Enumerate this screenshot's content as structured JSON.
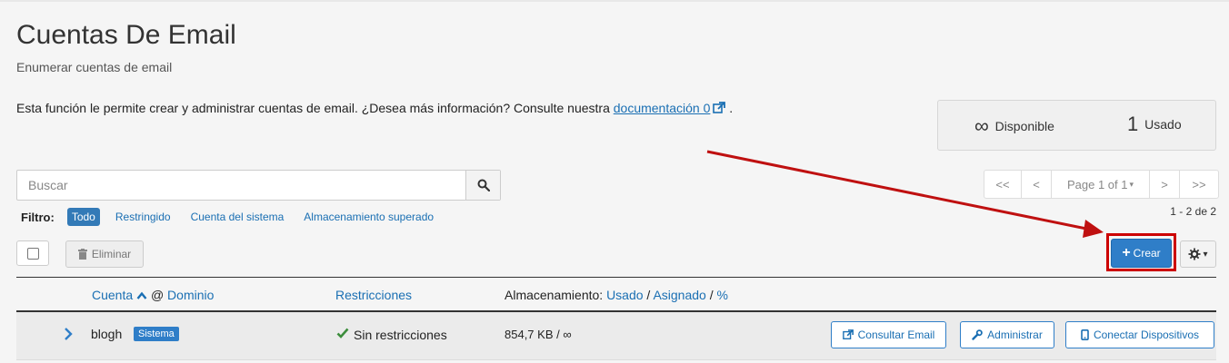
{
  "page": {
    "title": "Cuentas De Email",
    "subtitle": "Enumerar cuentas de email",
    "intro_text": "Esta función le permite crear y administrar cuentas de email. ¿Desea más información? Consulte nuestra",
    "doc_link": "documentación 0",
    "intro_end": "."
  },
  "stats": {
    "available_value": "∞",
    "available_label": "Disponible",
    "used_value": "1",
    "used_label": "Usado"
  },
  "search": {
    "placeholder": "Buscar"
  },
  "pagination": {
    "first": "<<",
    "prev": "<",
    "page_label": "Page 1 of 1",
    "next": ">",
    "last": ">>",
    "range": "1 - 2 de 2"
  },
  "filter": {
    "label": "Filtro:",
    "options": [
      "Todo",
      "Restringido",
      "Cuenta del sistema",
      "Almacenamiento superado"
    ],
    "active": "Todo"
  },
  "toolbar": {
    "delete_label": "Eliminar",
    "create_label": "Crear"
  },
  "table": {
    "col_account": "Cuenta",
    "col_at": "@",
    "col_domain": "Dominio",
    "col_restrictions": "Restricciones",
    "col_storage_prefix": "Almacenamiento:",
    "col_used": "Usado",
    "col_assigned": "Asignado",
    "col_percent": "%",
    "rows": [
      {
        "user": "blogh",
        "badge": "Sistema",
        "restrictions": "Sin restricciones",
        "storage": "854,7 KB / ∞",
        "actions": [
          "Consultar Email",
          "Administrar",
          "Conectar Dispositivos"
        ]
      }
    ]
  },
  "colors": {
    "accent": "#2f7ec8",
    "link": "#1a6fb3",
    "highlight": "#cc0000",
    "success": "#3c8d3c"
  },
  "icons": [
    "external-link-icon",
    "search-icon",
    "trash-icon",
    "plus-icon",
    "gear-icon",
    "caret-down-icon",
    "sort-up-icon",
    "chevron-right-icon",
    "check-icon",
    "wrench-icon",
    "phone-icon"
  ]
}
